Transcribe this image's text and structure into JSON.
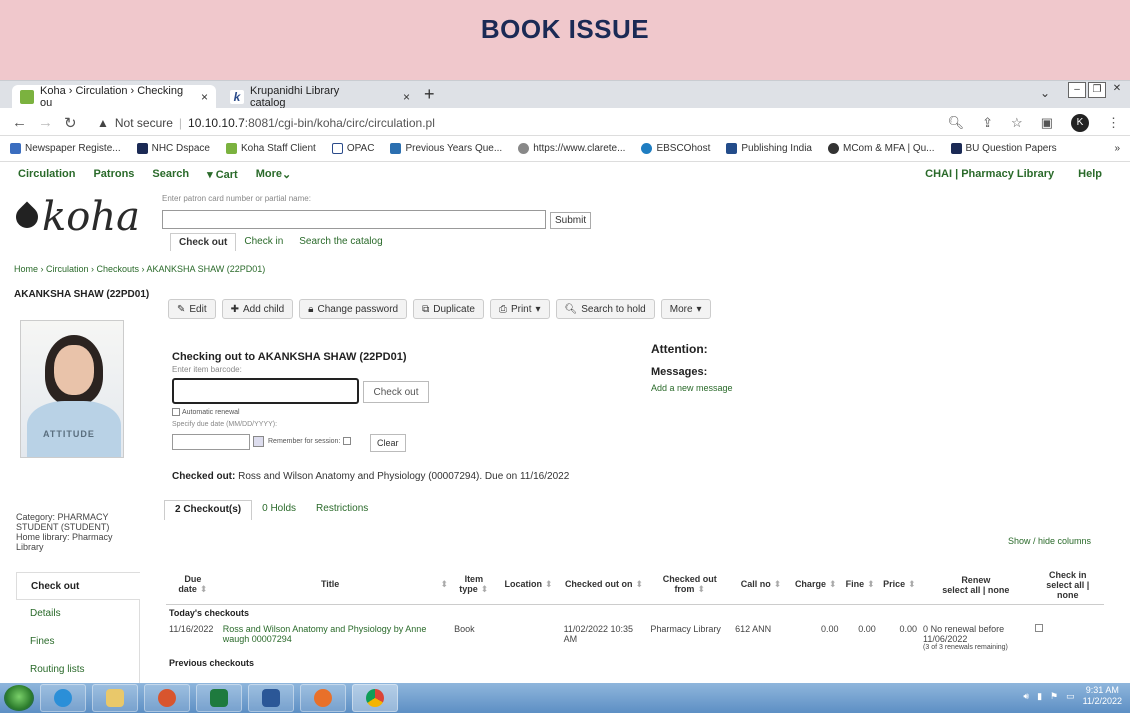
{
  "banner": {
    "title": "BOOK ISSUE"
  },
  "browser": {
    "tabs": [
      {
        "label": "Koha › Circulation › Checking ou",
        "close": "×"
      },
      {
        "label": "Krupanidhi Library catalog",
        "close": "×"
      }
    ],
    "new_tab": "+",
    "security": "Not secure",
    "url_host": "10.10.10.7",
    "url_rest": ":8081/cgi-bin/koha/circ/circulation.pl",
    "avatar": "K",
    "bookmarks": [
      "Newspaper Registe...",
      "NHC Dspace",
      "Koha Staff Client",
      "OPAC",
      "Previous Years Que...",
      "https://www.clarete...",
      "EBSCOhost",
      "Publishing India",
      "MCom & MFA | Qu...",
      "BU Question Papers"
    ],
    "more_bookmarks": "»"
  },
  "koha": {
    "nav": [
      "Circulation",
      "Patrons",
      "Search",
      "Cart",
      "More"
    ],
    "cart_icon": "▾",
    "library": "CHAI | Pharmacy Library",
    "help": "Help",
    "logo": "koha",
    "patron_hint": "Enter patron card number or partial name:",
    "submit": "Submit",
    "subtabs": [
      "Check out",
      "Check in",
      "Search the catalog"
    ],
    "breadcrumb": "Home › Circulation › Checkouts › AKANKSHA SHAW (22PD01)",
    "patron": "AKANKSHA SHAW (22PD01)",
    "toolbar": [
      "Edit",
      "Add child",
      "Change password",
      "Duplicate",
      "Print",
      "Search to hold",
      "More"
    ],
    "photo_print": "ATTITUDE",
    "checkout_heading": "Checking out to AKANKSHA SHAW (22PD01)",
    "barcode_hint": "Enter item barcode:",
    "checkout_button": "Check out",
    "auto_renew": "Automatic renewal",
    "due_hint": "Specify due date (MM/DD/YYYY):",
    "remember": "Remember for session:",
    "clear": "Clear",
    "attention": "Attention:",
    "messages": "Messages:",
    "add_message": "Add a new message",
    "checked_out_label": "Checked out:",
    "checked_out_text": "Ross and Wilson Anatomy and Physiology (00007294). Due on 11/16/2022",
    "checkout_tabs": [
      "2 Checkout(s)",
      "0 Holds",
      "Restrictions"
    ],
    "category": "Category: PHARMACY STUDENT (STUDENT)",
    "home_library": "Home library: Pharmacy Library",
    "show_hide": "Show / hide columns",
    "side_menu": [
      "Check out",
      "Details",
      "Fines",
      "Routing lists"
    ],
    "table": {
      "headers": [
        "Due date",
        "Title",
        "Item type",
        "Location",
        "Checked out on",
        "Checked out from",
        "Call no",
        "Charge",
        "Fine",
        "Price",
        "Renew",
        "Check in"
      ],
      "renew_sub": "select all | none",
      "checkin_sub": "select all | none",
      "group": "Today's checkouts",
      "row": {
        "due": "11/16/2022",
        "title": "Ross and Wilson Anatomy and Physiology by Anne waugh 00007294",
        "type": "Book",
        "location": "",
        "checked_on": "11/02/2022 10:35 AM",
        "from": "Pharmacy Library",
        "callno": "612 ANN",
        "charge": "0.00",
        "fine": "0.00",
        "price": "0.00",
        "renew_count": "0",
        "renew_text": "No renewal before 11/06/2022",
        "renew_remain": "(3 of 3 renewals remaining)"
      },
      "next_group": "Previous checkouts"
    }
  },
  "taskbar": {
    "time": "9:31 AM",
    "date": "11/2/2022"
  }
}
